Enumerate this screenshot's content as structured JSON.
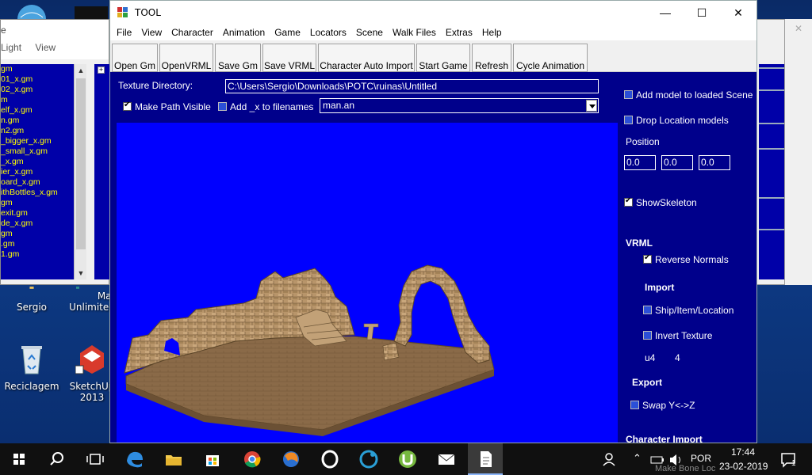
{
  "desktop": {
    "icons": [
      {
        "label": "Sergio"
      },
      {
        "label": "Maya Unlimited"
      },
      {
        "label": "Reciclagem"
      },
      {
        "label": "SketchUp 2013"
      }
    ]
  },
  "bg_window_left": {
    "title_fragment": "e",
    "menu": [
      "Light",
      "View"
    ],
    "files": [
      "gm",
      "01_x.gm",
      "02_x.gm",
      "m",
      "elf_x.gm",
      "n.gm",
      "n2.gm",
      "_bigger_x.gm",
      "_small_x.gm",
      "_x.gm",
      "ier_x.gm",
      "oard_x.gm",
      "ithBottles_x.gm",
      "gm",
      "exit.gm",
      "de_x.gm",
      "gm",
      ".gm",
      "1.gm"
    ]
  },
  "window": {
    "title": "TOOL",
    "menu": [
      "File",
      "View",
      "Character",
      "Animation",
      "Game",
      "Locators",
      "Scene",
      "Walk Files",
      "Extras",
      "Help"
    ],
    "toolbar": [
      "Open Gm",
      "OpenVRML",
      "Save Gm",
      "Save VRML",
      "Character Auto Import",
      "Start Game",
      "Refresh",
      "Cycle Animation"
    ]
  },
  "panel": {
    "texture_dir_label": "Texture Directory:",
    "texture_dir_value": "C:\\Users\\Sergio\\Downloads\\POTC\\ruinas\\Untitled",
    "make_path_visible": "Make Path Visible",
    "add_x": "Add _x to filenames",
    "anim_file": "man.an"
  },
  "side": {
    "add_model": "Add model to loaded Scene",
    "drop_location": "Drop Location models",
    "position_label": "Position",
    "pos_x": "0.0",
    "pos_y": "0.0",
    "pos_z": "0.0",
    "show_skeleton": "ShowSkeleton",
    "vrml": "VRML",
    "reverse_normals": "Reverse Normals",
    "import": "Import",
    "ship_item_location": "Ship/Item/Location",
    "invert_texture": "Invert Texture",
    "u4_label": "u4",
    "u4_value": "4",
    "export": "Export",
    "swap_yz": "Swap  Y<->Z",
    "character_import": "Character Import",
    "make_bone_loc": "Make Bone Loc"
  },
  "taskbar": {
    "lang": "POR",
    "time": "17:44",
    "date": "23-02-2019",
    "notif_count": "1"
  }
}
